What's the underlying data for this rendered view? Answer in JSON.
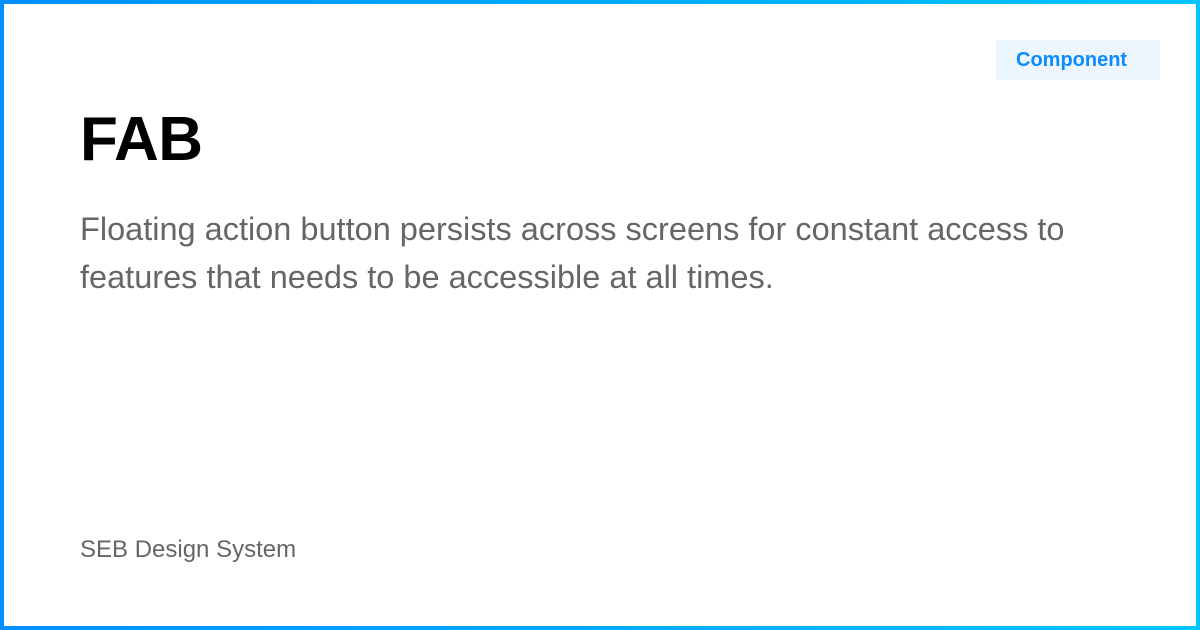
{
  "badge": "Component",
  "title": "FAB",
  "description": "Floating action button persists across screens for constant access to features that needs to be accessible at all times.",
  "footer": "SEB Design System",
  "colors": {
    "border_start": "#0090ff",
    "border_end": "#00c4ff",
    "badge_bg": "#edf6ff",
    "badge_text": "#0a8cff"
  }
}
